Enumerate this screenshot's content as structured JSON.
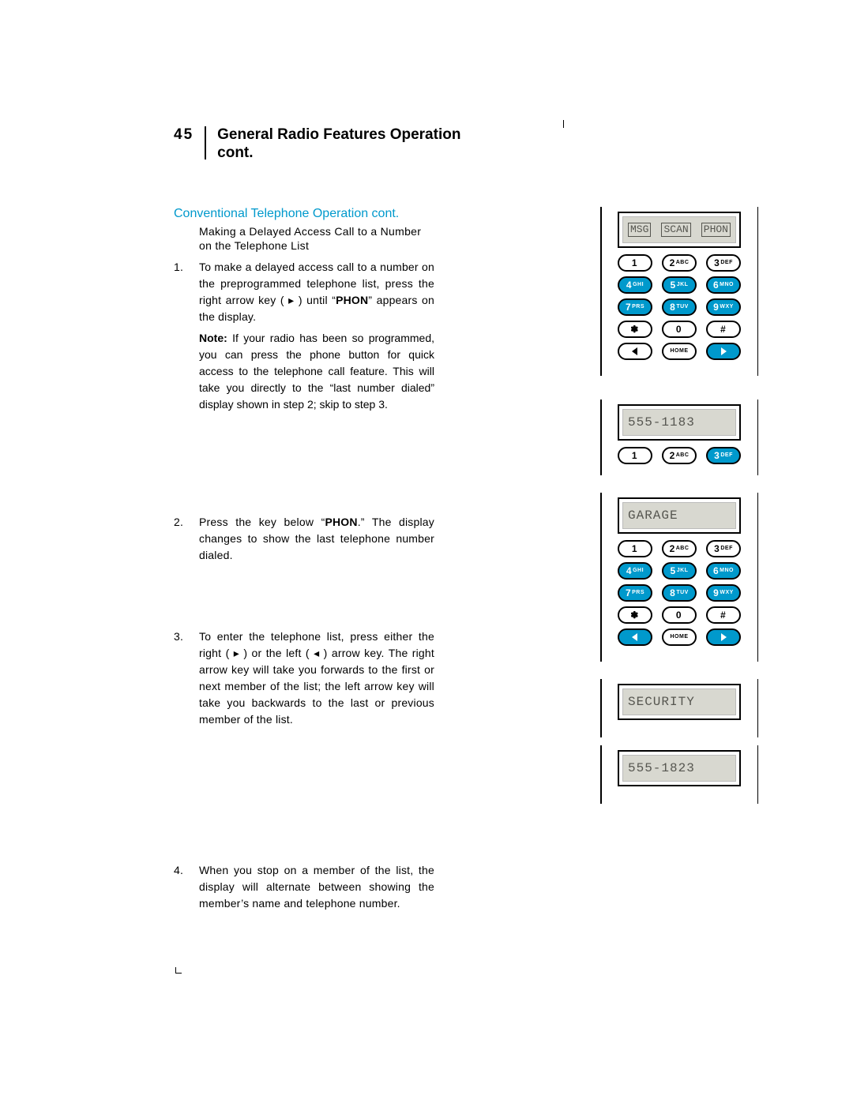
{
  "page": {
    "number": "45",
    "title_line1": "General Radio Features Operation",
    "title_line2": "cont."
  },
  "subhead": "Conventional Telephone Operation cont.",
  "lead": "Making a Delayed Access Call to a Number on the Telephone List",
  "steps": {
    "s1": {
      "num": "1.",
      "a": "To make a delayed access call to a number on the preprogrammed telephone list, press the right arrow key ( ▸ ) until “",
      "bold": "PHON",
      "b": "” appears on the display."
    },
    "note1": {
      "lead": "Note:",
      "rest": " If your radio has been so programmed, you can press the phone button for quick access to the telephone call feature. This will take you directly to the “last number dialed” display shown in step 2; skip to step 3."
    },
    "s2": {
      "num": "2.",
      "a": "Press the key below “",
      "bold": "PHON",
      "b": ".” The display changes to show the last telephone number dialed."
    },
    "s3": {
      "num": "3.",
      "text": "To enter the telephone list, press either the right ( ▸ ) or the left ( ◂ ) arrow key. The right arrow key will take you forwards to the first or next member of the list; the left arrow key will take you backwards to the last or previous member of the list."
    },
    "s4": {
      "num": "4.",
      "text": "When you stop on a member of the list, the display will alternate between showing the member’s name and telephone number."
    }
  },
  "displays": {
    "d1": {
      "soft": [
        "MSG",
        "SCAN",
        "PHON"
      ]
    },
    "d2": {
      "text": "555-1183"
    },
    "d3": {
      "text": "GARAGE"
    },
    "d4": {
      "text": "SECURITY"
    },
    "d5": {
      "text": "555-1823"
    }
  },
  "keys": {
    "k1": "1",
    "k2": {
      "n": "2",
      "s": "ABC"
    },
    "k3": {
      "n": "3",
      "s": "DEF"
    },
    "k4": {
      "n": "4",
      "s": "GHI"
    },
    "k5": {
      "n": "5",
      "s": "JKL"
    },
    "k6": {
      "n": "6",
      "s": "MNO"
    },
    "k7": {
      "n": "7",
      "s": "PRS"
    },
    "k8": {
      "n": "8",
      "s": "TUV"
    },
    "k9": {
      "n": "9",
      "s": "WXY"
    },
    "kstar": "✽",
    "k0": "0",
    "khash": "#",
    "khome": "HOME"
  }
}
